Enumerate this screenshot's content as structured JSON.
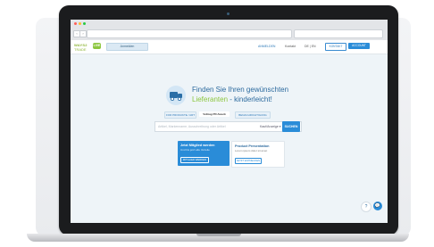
{
  "logo": {
    "top": "WAYS2",
    "bottom": "TRADE"
  },
  "header": {
    "live_badge": "LIVE",
    "tab_label": "Anmelden",
    "links": [
      "ANMELDEN",
      "Kontakt"
    ],
    "language": "DE | EN",
    "contact_label": "KONTAKT",
    "account_label": "ACCOUNT"
  },
  "hero": {
    "title_line1": "Finden Sie Ihren gewünschten",
    "title_word_green": "Lieferanten",
    "title_rest": " - kinderleicht!"
  },
  "chips": [
    "FOR PRODUKTE / ART",
    "Vollzug PD Awsck",
    "BENACHRICHTIGUNG"
  ],
  "search": {
    "placeholder": "Artikel, Markenname, Ausschreibung oder Artikel",
    "select_value": "Kauf/Anzeige ▾",
    "button": "SUCHEN"
  },
  "cards": [
    {
      "title": "Jetzt Mitglied werden",
      "text": "Und bis jetzt alle Vorteile",
      "button": "MITGLIED WERDEN"
    },
    {
      "title": "Product Presentation",
      "text": "Lorem ipsum dolor sit amet",
      "button": "JETZT ENTDECKEN"
    }
  ],
  "fab": {
    "help": "?",
    "chat": "💬"
  },
  "colors": {
    "accent_blue": "#2a8cd8",
    "accent_green": "#8cc63f",
    "title_blue": "#2c6a9e"
  }
}
